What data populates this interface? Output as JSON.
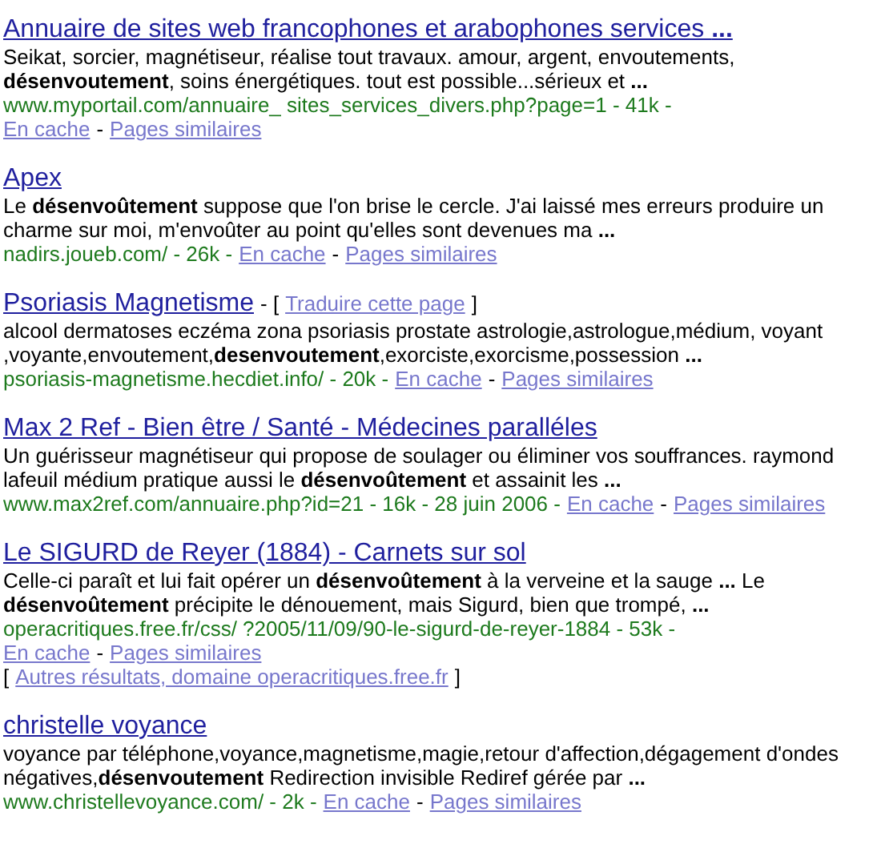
{
  "results": [
    {
      "title": "Annuaire de sites web francophones et arabophones services **...**",
      "snippet": "Seikat, sorcier, magnétiseur, réalise tout travaux. amour, argent, envoutements, **désenvoutement**, soins énergétiques. tout est possible...sérieux et **...**",
      "meta_lines": [
        [
          {
            "kind": "url",
            "text": "www.myportail.com/annuaire_ sites_services_divers.php?page=1 - 41k -"
          }
        ],
        [
          {
            "kind": "link",
            "text": "En cache"
          },
          {
            "kind": "plain",
            "text": "-"
          },
          {
            "kind": "link",
            "text": "Pages similaires"
          }
        ]
      ]
    },
    {
      "title": "Apex",
      "snippet": "Le **désenvoûtement** suppose que l'on brise le cercle. J'ai laissé mes erreurs produire un charme sur moi, m'envoûter au point qu'elles sont devenues ma **...**",
      "meta_lines": [
        [
          {
            "kind": "url",
            "text": "nadirs.joueb.com/ - 26k -"
          },
          {
            "kind": "link",
            "text": "En cache"
          },
          {
            "kind": "plain",
            "text": "-"
          },
          {
            "kind": "link",
            "text": "Pages similaires"
          }
        ]
      ]
    },
    {
      "title": "Psoriasis Magnetisme",
      "title_extras": [
        {
          "kind": "plain",
          "text": "- ["
        },
        {
          "kind": "link",
          "text": "Traduire cette page"
        },
        {
          "kind": "plain",
          "text": "]"
        }
      ],
      "snippet": "alcool dermatoses eczéma zona psoriasis prostate astrologie,astrologue,médium, voyant ,voyante,envoutement,**desenvoutement**,exorciste,exorcisme,possession **...**",
      "meta_lines": [
        [
          {
            "kind": "url",
            "text": "psoriasis-magnetisme.hecdiet.info/ - 20k -"
          },
          {
            "kind": "link",
            "text": "En cache"
          },
          {
            "kind": "plain",
            "text": "-"
          },
          {
            "kind": "link",
            "text": "Pages similaires"
          }
        ]
      ]
    },
    {
      "title": "Max 2 Ref - Bien être / Santé - Médecines paralléles",
      "snippet": "Un guérisseur magnétiseur qui propose de soulager ou éliminer vos souffrances. raymond lafeuil médium pratique aussi le **désenvoûtement** et assainit les **...**",
      "meta_lines": [
        [
          {
            "kind": "url",
            "text": "www.max2ref.com/annuaire.php?id=21 - 16k - 28 juin 2006 -"
          },
          {
            "kind": "link",
            "text": "En cache"
          },
          {
            "kind": "plain",
            "text": "-"
          },
          {
            "kind": "link",
            "text": "Pages similaires"
          }
        ]
      ]
    },
    {
      "title": "Le SIGURD de Reyer (1884) - Carnets sur sol",
      "snippet": "Celle-ci paraît et lui fait opérer un **désenvoûtement** à la verveine et la sauge **...** Le **désenvoûtement** précipite le dénouement, mais Sigurd, bien que trompé, **...**",
      "meta_lines": [
        [
          {
            "kind": "url",
            "text": "operacritiques.free.fr/css/ ?2005/11/09/90-le-sigurd-de-reyer-1884 - 53k -"
          }
        ],
        [
          {
            "kind": "link",
            "text": "En cache"
          },
          {
            "kind": "plain",
            "text": "-"
          },
          {
            "kind": "link",
            "text": "Pages similaires"
          }
        ],
        [
          {
            "kind": "plain",
            "text": "["
          },
          {
            "kind": "link",
            "text": "Autres résultats, domaine operacritiques.free.fr"
          },
          {
            "kind": "plain",
            "text": "]"
          }
        ]
      ]
    },
    {
      "title": "christelle voyance",
      "snippet": "voyance par téléphone,voyance,magnetisme,magie,retour d'affection,dégagement d'ondes négatives,**désenvoutement** Redirection invisible Rediref gérée par **...**",
      "meta_lines": [
        [
          {
            "kind": "url",
            "text": "www.christellevoyance.com/ - 2k -"
          },
          {
            "kind": "link",
            "text": "En cache"
          },
          {
            "kind": "plain",
            "text": "-"
          },
          {
            "kind": "link",
            "text": "Pages similaires"
          }
        ]
      ]
    }
  ]
}
